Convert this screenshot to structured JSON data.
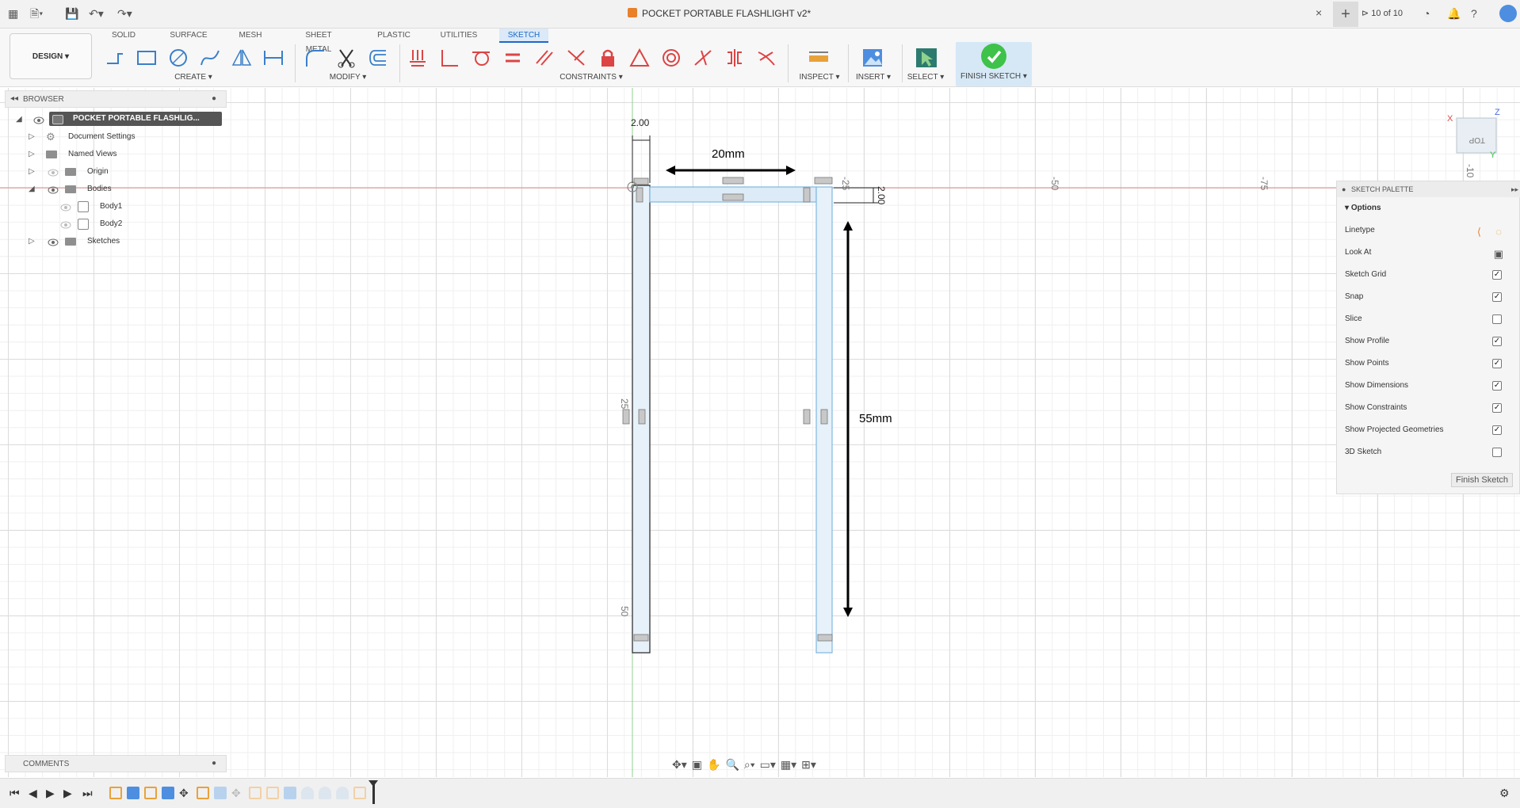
{
  "title_bar": {
    "doc_title": "POCKET PORTABLE FLASHLIGHT v2*",
    "job_status": "10 of 10",
    "close_tab": "×",
    "new_tab": "+"
  },
  "workspace": {
    "label": "DESIGN ▾"
  },
  "tabs": [
    {
      "label": "SOLID"
    },
    {
      "label": "SURFACE"
    },
    {
      "label": "MESH"
    },
    {
      "label": "SHEET METAL"
    },
    {
      "label": "PLASTIC"
    },
    {
      "label": "UTILITIES"
    },
    {
      "label": "SKETCH",
      "active": true
    }
  ],
  "groups": {
    "create": "CREATE ▾",
    "modify": "MODIFY ▾",
    "constraints": "CONSTRAINTS ▾",
    "inspect": "INSPECT ▾",
    "insert": "INSERT ▾",
    "select": "SELECT ▾",
    "finish_sketch": "FINISH SKETCH ▾"
  },
  "browser": {
    "header": "BROWSER",
    "root": "POCKET PORTABLE FLASHLIG...",
    "items": [
      {
        "label": "Document Settings"
      },
      {
        "label": "Named Views"
      },
      {
        "label": "Origin"
      },
      {
        "label": "Bodies"
      },
      {
        "label": "Body1"
      },
      {
        "label": "Body2"
      },
      {
        "label": "Sketches"
      }
    ]
  },
  "dimensions": {
    "top_width": "2.00",
    "side_width": "2.00",
    "span_width": "20mm",
    "height": "55mm"
  },
  "ruler_labels": [
    "-25",
    "-50",
    "-75",
    "-10",
    "25",
    "50"
  ],
  "viewcube": {
    "face": "TOP",
    "x_axis": "X",
    "y_axis": "Y",
    "z_axis": "Z"
  },
  "palette": {
    "header": "SKETCH PALETTE",
    "section": "Options",
    "options": [
      {
        "label": "Linetype"
      },
      {
        "label": "Look At"
      },
      {
        "label": "Sketch Grid",
        "checked": true
      },
      {
        "label": "Snap",
        "checked": true
      },
      {
        "label": "Slice",
        "checked": false
      },
      {
        "label": "Show Profile",
        "checked": true
      },
      {
        "label": "Show Points",
        "checked": true
      },
      {
        "label": "Show Dimensions",
        "checked": true
      },
      {
        "label": "Show Constraints",
        "checked": true
      },
      {
        "label": "Show Projected Geometries",
        "checked": true
      },
      {
        "label": "3D Sketch",
        "checked": false
      }
    ],
    "finish_button": "Finish Sketch"
  },
  "comments": {
    "header": "COMMENTS"
  },
  "colors": {
    "accent": "#1b6ac9",
    "sketch_fill": "#e6f1fa",
    "sketch_line_blue": "#7fb8e0",
    "axis_red": "#e58b8b",
    "axis_green": "#8fd18f",
    "finish_green": "#3ec24a"
  }
}
